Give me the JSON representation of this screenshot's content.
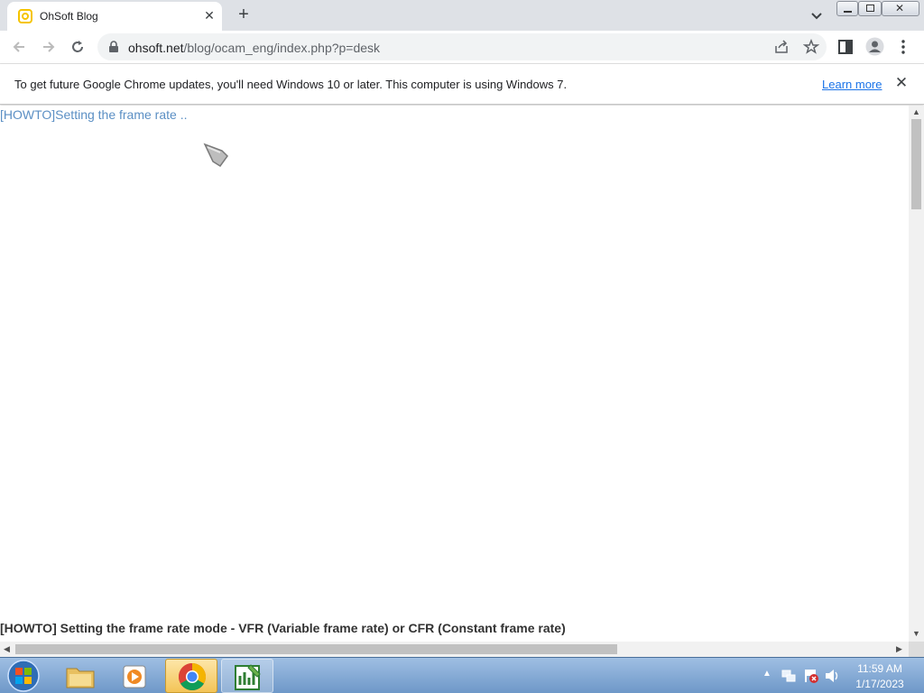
{
  "tab": {
    "title": "OhSoft Blog",
    "close_icon": "close-icon",
    "new_tab_icon": "plus-icon"
  },
  "toolbar": {
    "url_host": "ohsoft.net",
    "url_path": "/blog/ocam_eng/index.php?p=desk"
  },
  "infobar": {
    "message": "To get future Google Chrome updates, you'll need Windows 10 or later. This computer is using Windows 7.",
    "learn_more": "Learn more"
  },
  "content": {
    "post_link": "[HOWTO]Setting the frame rate ..",
    "post_heading": "[HOWTO] Setting the frame rate mode - VFR (Variable frame rate) or CFR (Constant frame rate)"
  },
  "taskbar": {
    "time": "11:59 AM",
    "date": "1/17/2023",
    "items": [
      "start-orb",
      "file-explorer",
      "media-player",
      "google-chrome",
      "spreadsheet-app"
    ]
  },
  "colors": {
    "link": "#5b8fc4",
    "tabstrip": "#dee1e6",
    "taskbar": "#6e98c8"
  }
}
